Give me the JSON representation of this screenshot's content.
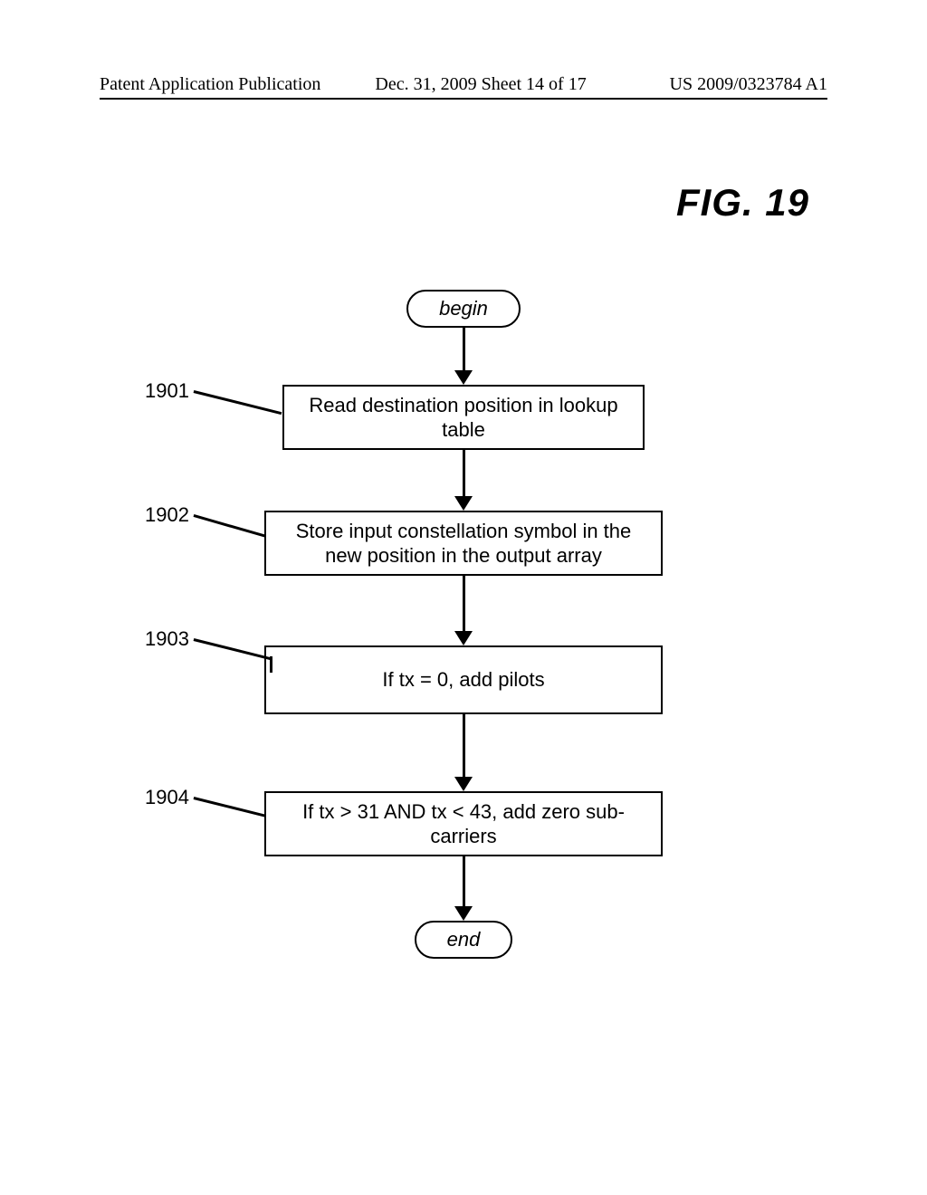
{
  "header": {
    "left": "Patent Application Publication",
    "mid": "Dec. 31, 2009  Sheet 14 of 17",
    "right": "US 2009/0323784 A1"
  },
  "figure_title": "FIG. 19",
  "refs": {
    "r1901": "1901",
    "r1902": "1902",
    "r1903": "1903",
    "r1904": "1904"
  },
  "nodes": {
    "begin": "begin",
    "step1901": "Read destination position in lookup table",
    "step1902": "Store input constellation symbol in the new position in the output array",
    "step1903": "If tx = 0, add pilots",
    "step1904": "If tx > 31 AND tx < 43, add zero sub-carriers",
    "end": "end"
  }
}
